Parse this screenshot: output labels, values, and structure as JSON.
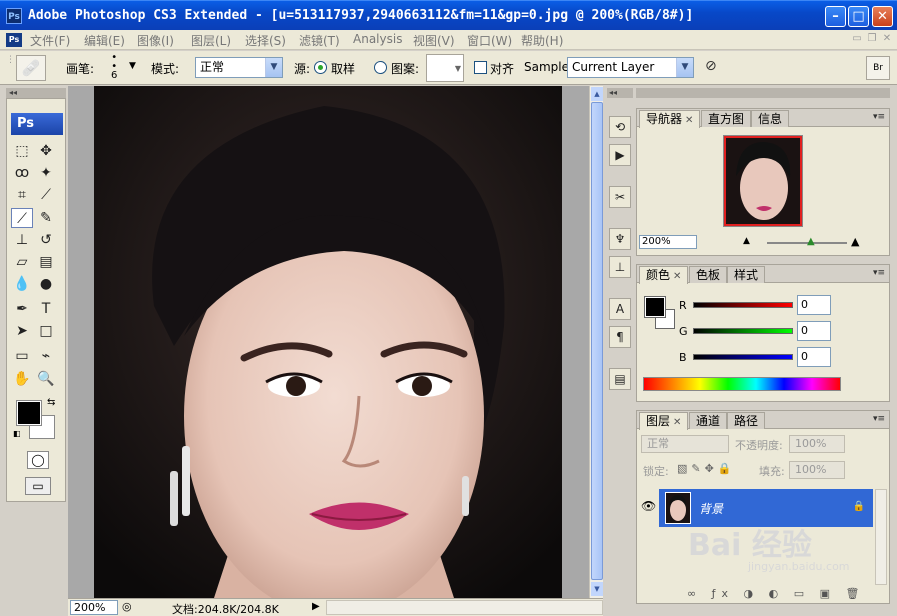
{
  "window": {
    "app_icon": "Ps",
    "title": "Adobe Photoshop CS3 Extended - [u=513117937,2940663112&fm=11&gp=0.jpg @ 200%(RGB/8#)]",
    "minimize": "–",
    "maximize": "□",
    "close": "✕"
  },
  "menu": {
    "icon": "Ps",
    "items": [
      "文件(F)",
      "编辑(E)",
      "图像(I)",
      "图层(L)",
      "选择(S)",
      "滤镜(T)",
      "Analysis",
      "视图(V)",
      "窗口(W)",
      "帮助(H)"
    ]
  },
  "options": {
    "brush_label": "画笔:",
    "brush_size": "6",
    "mode_label": "模式:",
    "mode_value": "正常",
    "source_label": "源:",
    "sampled_label": "取样",
    "pattern_label": "图案:",
    "aligned_label": "对齐",
    "sample_label": "Sample:",
    "sample_value": "Current Layer"
  },
  "tools": {
    "logo": "Ps",
    "fg_color": "#000000",
    "bg_color": "#ffffff"
  },
  "status": {
    "zoom": "200%",
    "doc_info": "文档:204.8K/204.8K"
  },
  "navigator_panel": {
    "tabs": [
      "导航器",
      "直方图",
      "信息"
    ],
    "zoom": "200%"
  },
  "color_panel": {
    "tabs": [
      "颜色",
      "色板",
      "样式"
    ],
    "r_label": "R",
    "r_value": "0",
    "g_label": "G",
    "g_value": "0",
    "b_label": "B",
    "b_value": "0"
  },
  "layers_panel": {
    "tabs": [
      "图层",
      "通道",
      "路径"
    ],
    "blend_mode": "正常",
    "opacity_label": "不透明度:",
    "opacity_value": "100%",
    "lock_label": "锁定:",
    "fill_label": "填充:",
    "fill_value": "100%",
    "layer_name": "背景"
  },
  "watermark": {
    "text": "Bai 经验",
    "url": "jingyan.baidu.com"
  }
}
